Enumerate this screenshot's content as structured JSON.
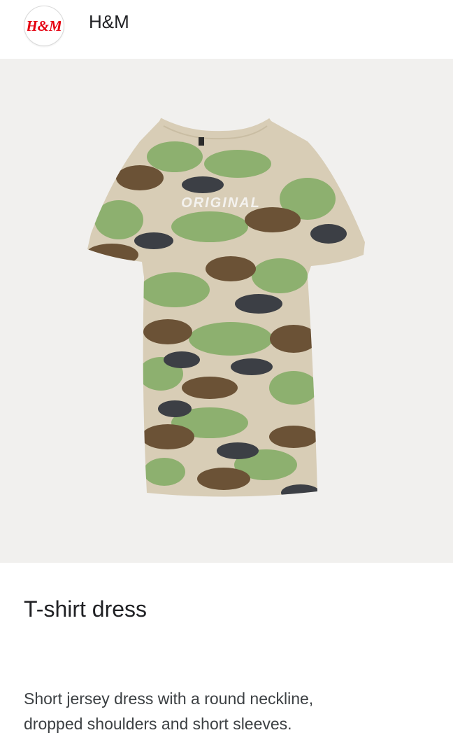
{
  "header": {
    "logo_text": "H&M",
    "brand_name": "H&M",
    "logo_color": "#e50010"
  },
  "product": {
    "image_icon": "camo-tshirt-dress-image",
    "print_text": "ORIGINAL",
    "title": "T-shirt dress",
    "description_line1": "Short jersey dress with a round neckline,",
    "description_line2": "dropped shoulders and short sleeves."
  },
  "colors": {
    "camo_beige": "#d8cdb6",
    "camo_green": "#8db06f",
    "camo_brown": "#6b5236",
    "camo_charcoal": "#3c3f45",
    "background": "#f1f0ee"
  }
}
